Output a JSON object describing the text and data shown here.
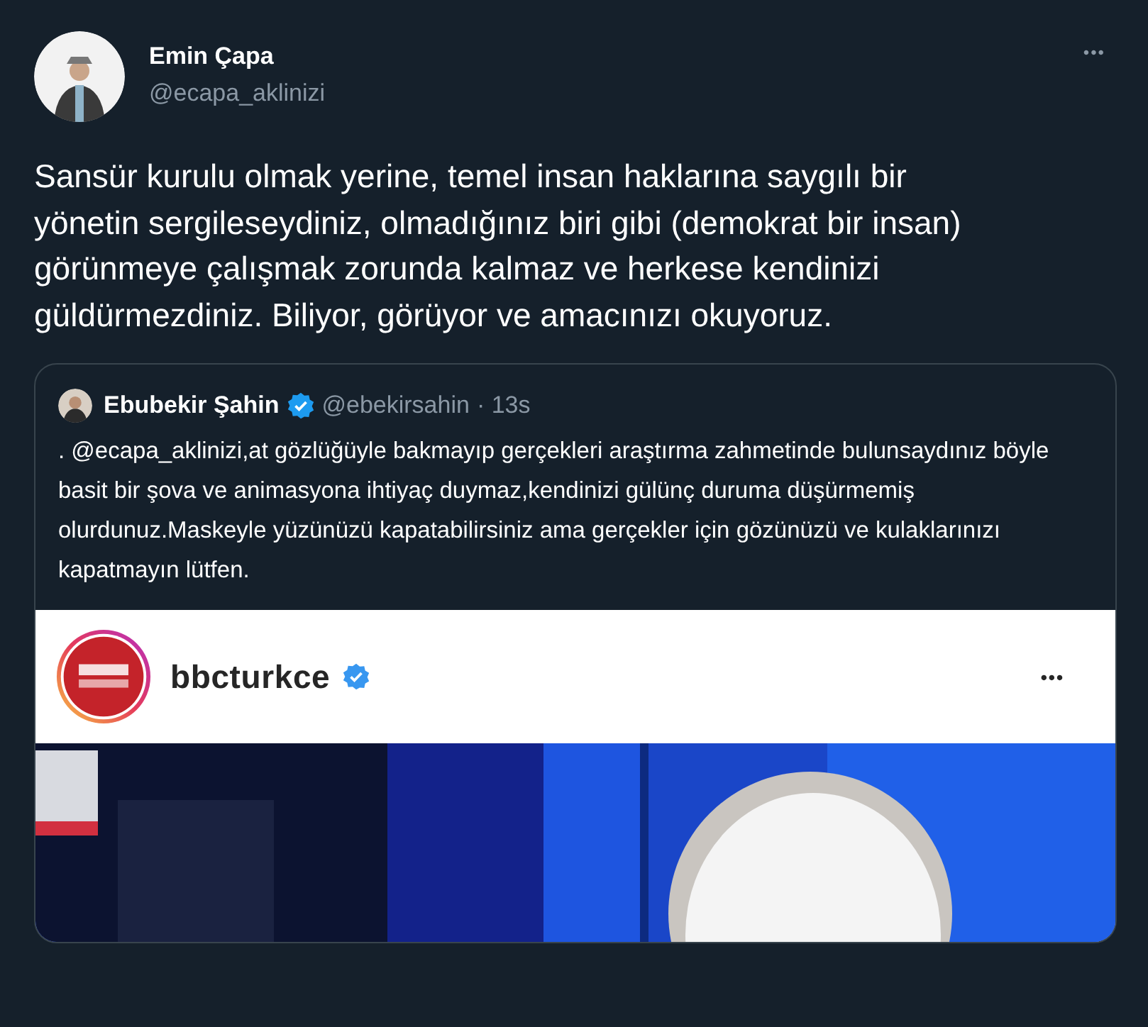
{
  "author": {
    "name": "Emin Çapa",
    "handle": "@ecapa_aklinizi",
    "more": "•••"
  },
  "text": "Sansür kurulu olmak yerine, temel insan haklarına saygılı bir yönetin sergileseydiniz, olmadığınız biri gibi (demokrat bir insan) görünmeye çalışmak zorunda kalmaz ve herkese kendinizi güldürmezdiniz. Biliyor, görüyor ve amacınızı okuyoruz.",
  "quote": {
    "name": "Ebubekir Şahin",
    "verified": true,
    "handle": "@ebekirsahin",
    "time": "· 13s",
    "text": ". @ecapa_aklinizi,at gözlüğüyle bakmayıp gerçekleri araştırma zahmetinde bulunsaydınız böyle basit bir şova ve animasyona ihtiyaç duymaz,kendinizi gülünç duruma düşürmemiş olurdunuz.Maskeyle yüzünüzü kapatabilirsiniz ama gerçekler için gözünüzü ve kulaklarınızı kapatmayın lütfen.",
    "embed": {
      "account": "bbcturkce",
      "verified": true,
      "more": "•••"
    }
  }
}
